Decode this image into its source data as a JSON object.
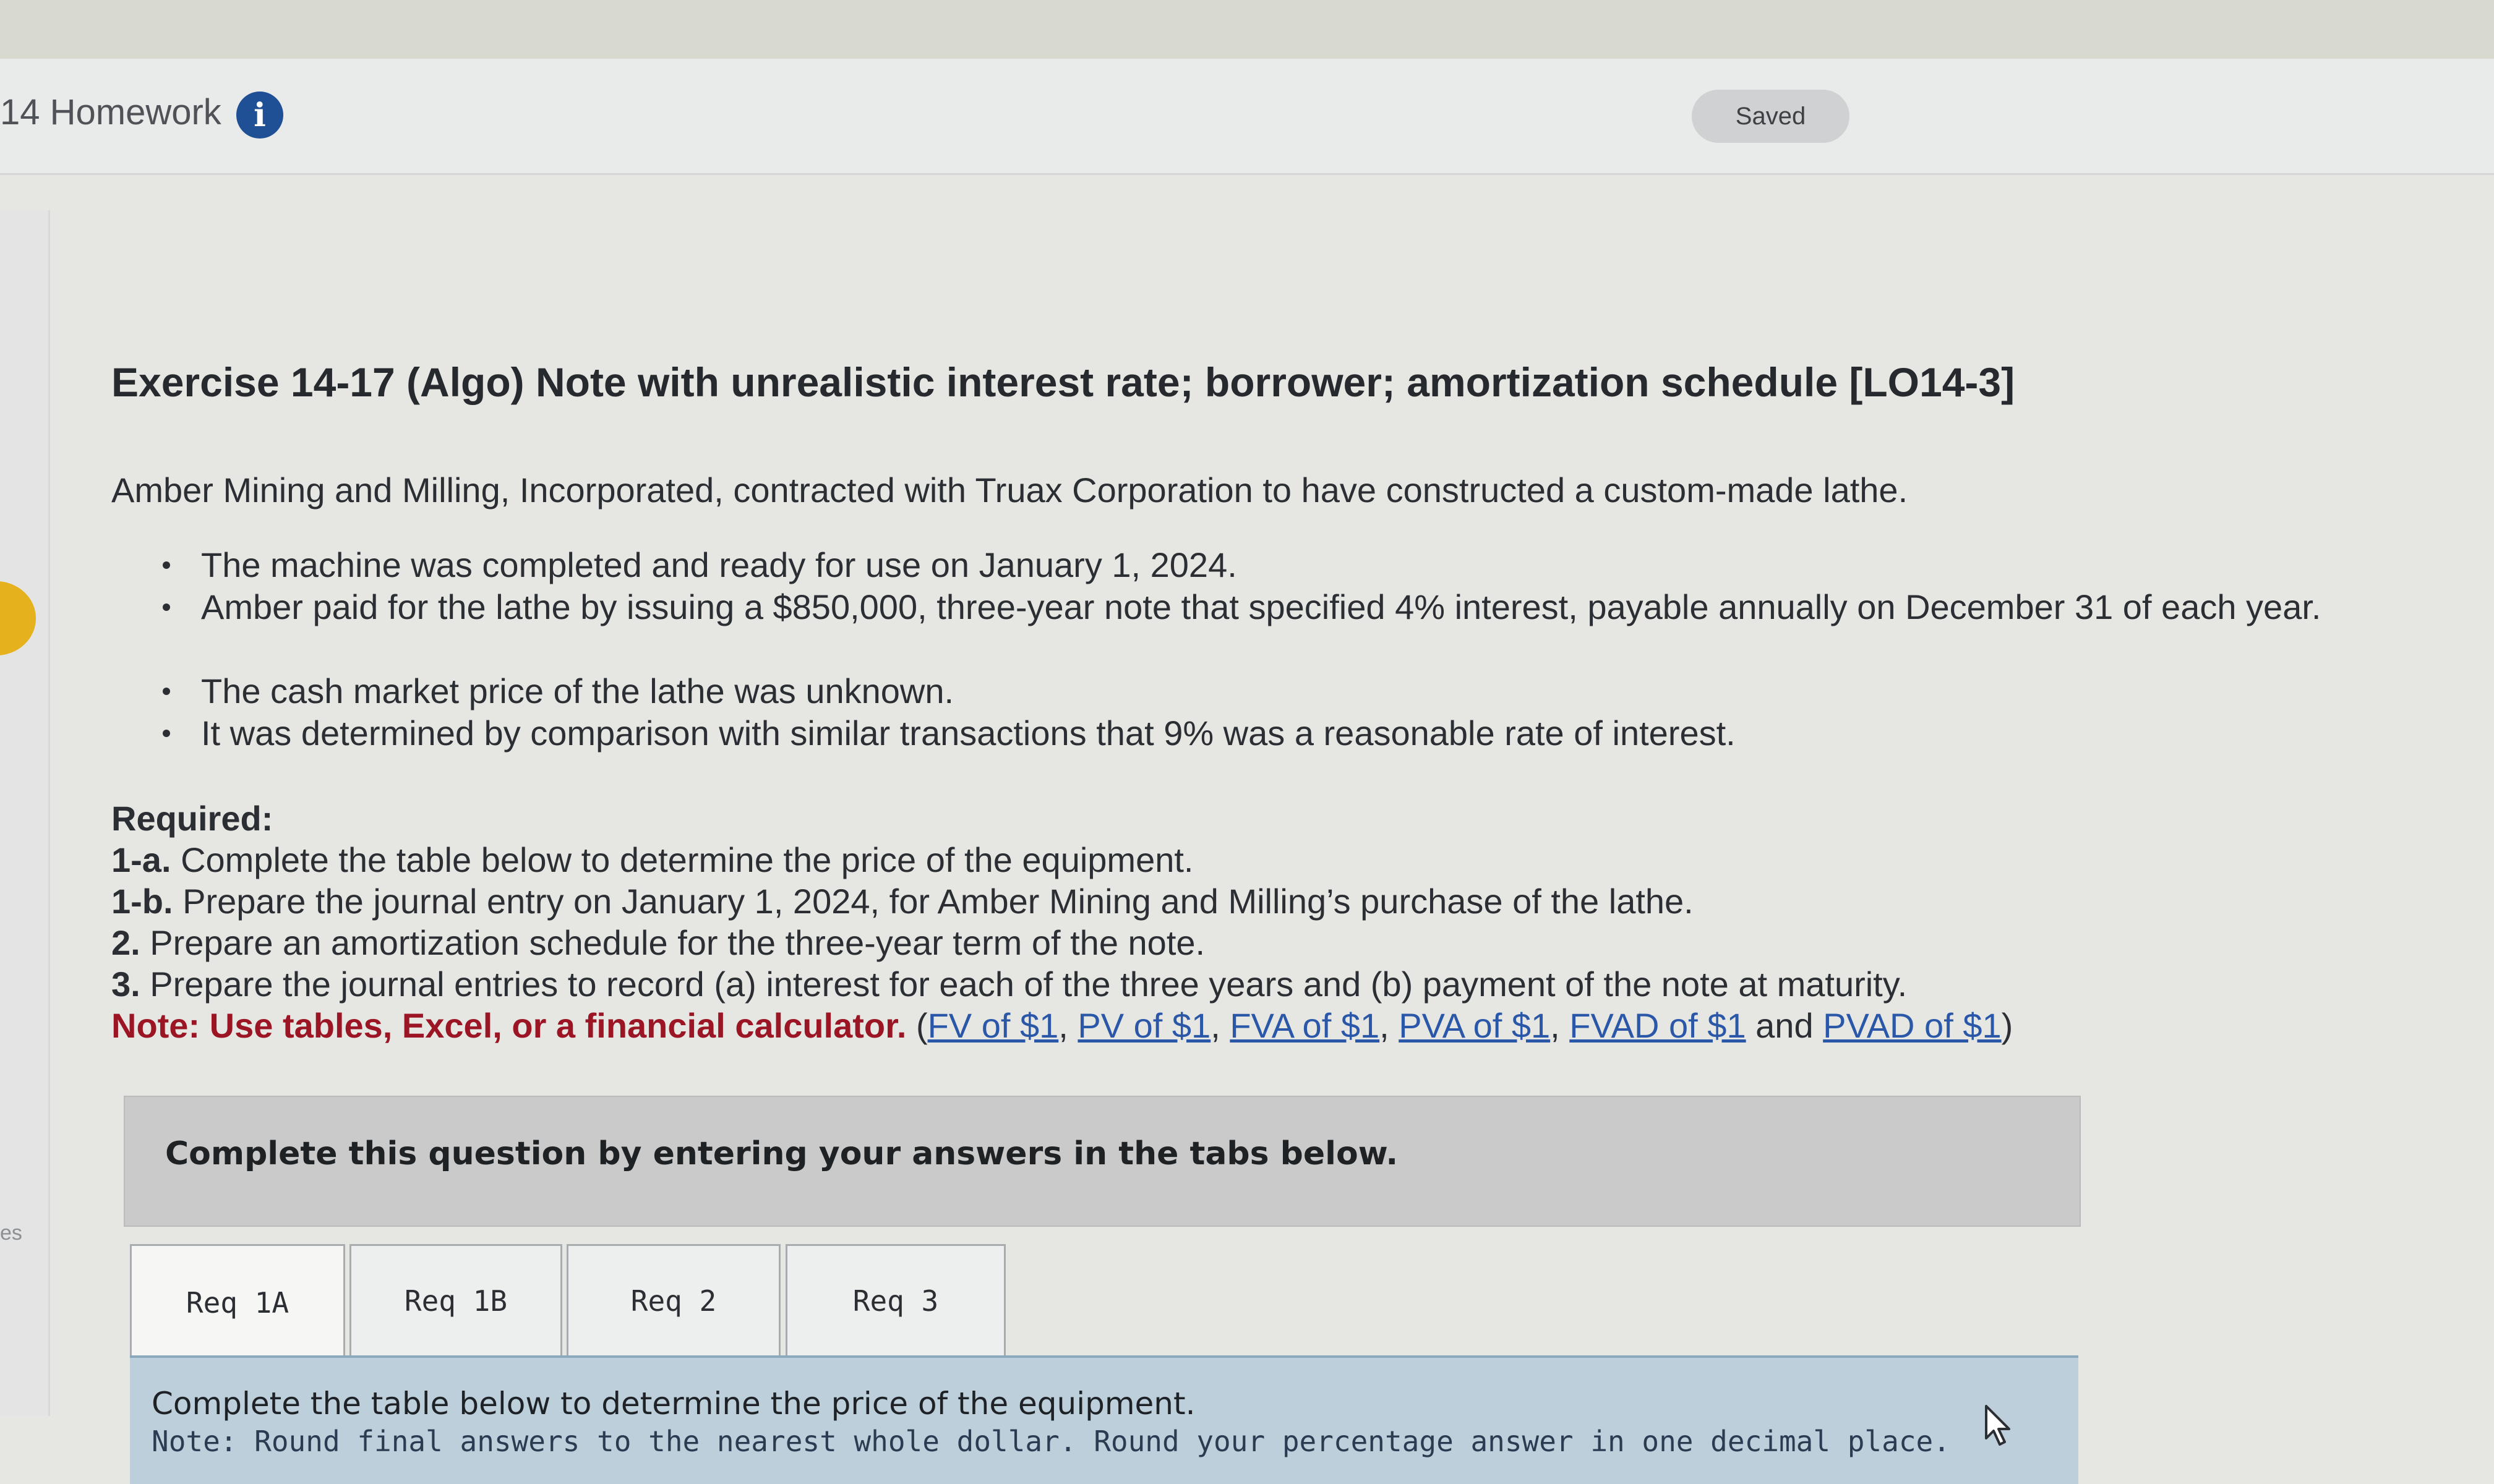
{
  "header": {
    "assignment_title": "14 Homework",
    "info_icon": "info-icon",
    "status": "Saved"
  },
  "left_rail": {
    "label": "es"
  },
  "exercise": {
    "title": "Exercise 14-17 (Algo) Note with unrealistic interest rate; borrower; amortization schedule [LO14-3]",
    "intro": "Amber Mining and Milling, Incorporated, contracted with Truax Corporation to have constructed a custom-made lathe.",
    "bullets": [
      "The machine was completed and ready for use on January 1, 2024.",
      "Amber paid for the lathe by issuing a $850,000, three-year note that specified 4% interest, payable annually on December 31 of each year.",
      "The cash market price of the lathe was unknown.",
      "It was determined by comparison with similar transactions that 9% was a reasonable rate of interest."
    ],
    "required_heading": "Required:",
    "required_items": [
      {
        "num": "1-a.",
        "text": "Complete the table below to determine the price of the equipment."
      },
      {
        "num": "1-b.",
        "text": "Prepare the journal entry on January 1, 2024, for Amber Mining and Milling’s purchase of the lathe."
      },
      {
        "num": "2.",
        "text": "Prepare an amortization schedule for the three-year term of the note."
      },
      {
        "num": "3.",
        "text": "Prepare the journal entries to record (a) interest for each of the three years and (b) payment of the note at maturity."
      }
    ],
    "note_label": "Note: Use tables, Excel, or a financial calculator.",
    "table_links": [
      "FV of $1",
      "PV of $1",
      "FVA of $1",
      "PVA of $1",
      "FVAD of $1",
      "PVAD of $1"
    ],
    "link_sep": ", ",
    "link_and": " and "
  },
  "instructions": "Complete this question by entering your answers in the tabs below.",
  "tabs": [
    {
      "label": "Req 1A",
      "active": true
    },
    {
      "label": "Req 1B",
      "active": false
    },
    {
      "label": "Req 2",
      "active": false
    },
    {
      "label": "Req 3",
      "active": false
    }
  ],
  "panel": {
    "line1": "Complete the table below to determine the price of the equipment.",
    "line2": "Note: Round final answers to the nearest whole dollar. Round your percentage answer in one decimal place."
  },
  "colors": {
    "info_icon": "#1f4f95",
    "note_red": "#9b1524",
    "link_blue": "#2a57a8",
    "panel_bg": "#bccfda",
    "highlight_yellow": "#e5b11c"
  },
  "cursor_icon": "mouse-pointer-icon"
}
